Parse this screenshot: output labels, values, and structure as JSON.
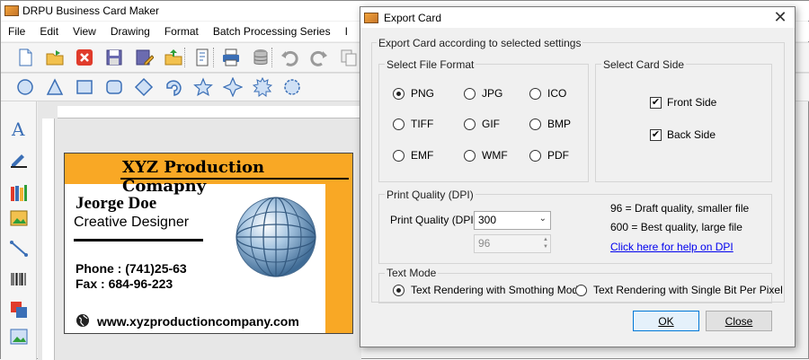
{
  "app": {
    "title": "DRPU Business Card Maker",
    "menu": [
      "File",
      "Edit",
      "View",
      "Drawing",
      "Format",
      "Batch Processing Series",
      "I"
    ]
  },
  "card": {
    "company": "XYZ Production Comapny",
    "name": "Jeorge Doe",
    "role": "Creative Designer",
    "phone": "Phone : (741)25-63",
    "fax": "Fax : 684-96-223",
    "website": "www.xyzproductioncompany.com",
    "colors": {
      "accent": "#f9a825"
    }
  },
  "dialog": {
    "title": "Export Card",
    "heading": "Export Card according to selected settings",
    "file_format": {
      "label": "Select File Format",
      "options": [
        "PNG",
        "JPG",
        "ICO",
        "TIFF",
        "GIF",
        "BMP",
        "EMF",
        "WMF",
        "PDF"
      ],
      "selected": "PNG"
    },
    "card_side": {
      "label": "Select Card Side",
      "front": "Front Side",
      "back": "Back Side",
      "front_checked": true,
      "back_checked": true
    },
    "print_quality": {
      "group_label": "Print Quality (DPI)",
      "field_label": "Print Quality (DPI) :",
      "value": "300",
      "custom_value": "96",
      "hint_low": "96 = Draft quality, smaller file",
      "hint_high": "600  = Best quality, large file",
      "help_link": "Click here for help on DPI"
    },
    "text_mode": {
      "label": "Text Mode",
      "option1": "Text Rendering with Smothing Mode",
      "option2": "Text Rendering with Single Bit Per Pixel",
      "selected": "option1"
    },
    "ok_label": "OK",
    "close_label": "Close"
  }
}
